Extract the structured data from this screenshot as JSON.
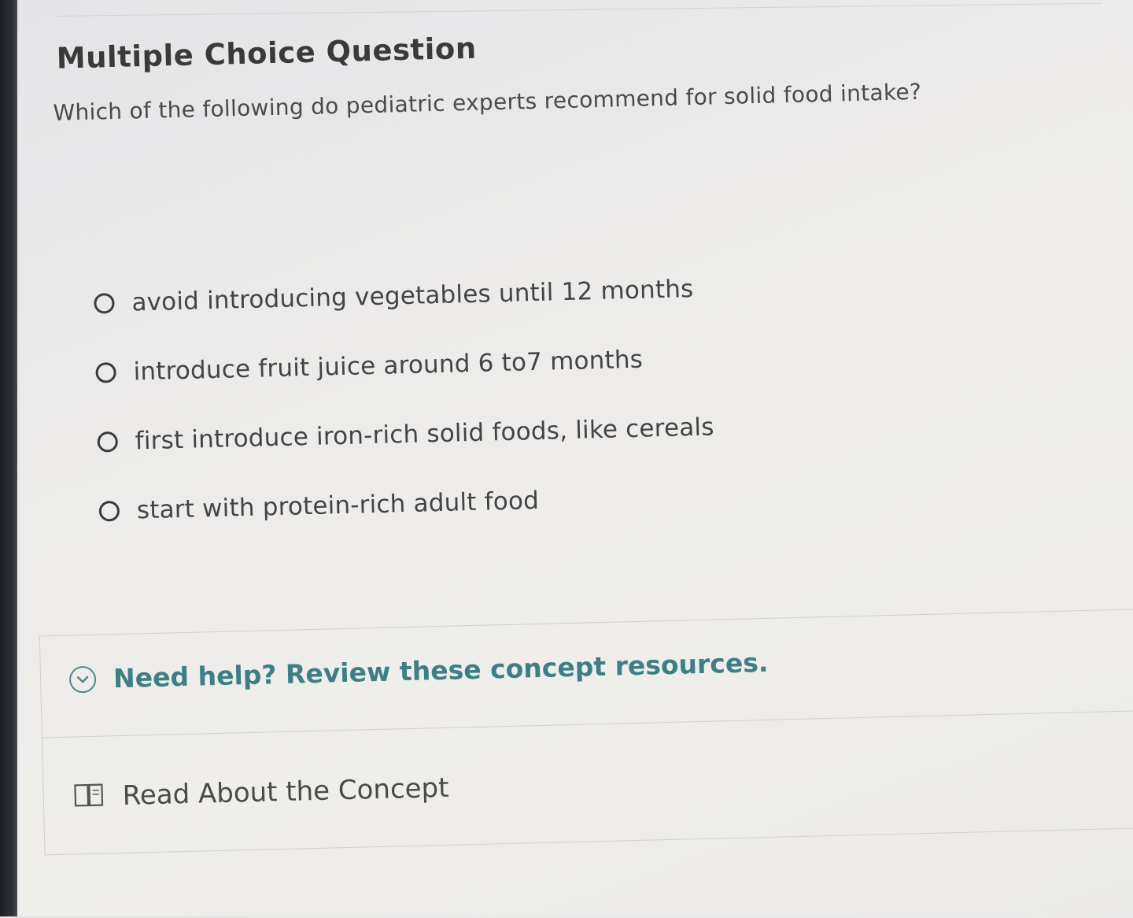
{
  "question": {
    "type_label": "Multiple Choice Question",
    "prompt": "Which of the following do pediatric experts recommend for solid food intake?"
  },
  "options": [
    {
      "label": "avoid introducing vegetables until 12 months",
      "selected": false
    },
    {
      "label": "introduce fruit juice around 6 to7 months",
      "selected": false
    },
    {
      "label": "first introduce iron-rich solid foods, like cereals",
      "selected": false
    },
    {
      "label": "start with protein-rich adult food",
      "selected": false
    }
  ],
  "help": {
    "icon": "chevron-down-circle-icon",
    "label": "Need help? Review these concept resources."
  },
  "resources": {
    "icon": "book-icon",
    "read_label": "Read About the Concept"
  },
  "colors": {
    "accent": "#3d7f85",
    "text": "#444444",
    "background": "#ecebea"
  }
}
